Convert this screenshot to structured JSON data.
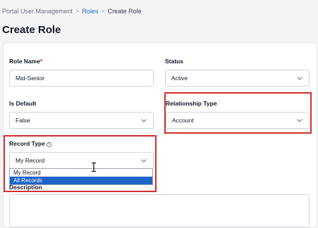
{
  "breadcrumb": {
    "root": "Portal User Management",
    "roles": "Roles",
    "current": "Create Role",
    "separator": ">"
  },
  "page_title": "Create Role",
  "form": {
    "role_name": {
      "label": "Role Name",
      "required_mark": "*",
      "value": "Mid-Senior"
    },
    "status": {
      "label": "Status",
      "value": "Active"
    },
    "is_default": {
      "label": "Is Default",
      "value": "False"
    },
    "relationship_type": {
      "label": "Relationship Type",
      "value": "Account"
    },
    "record_type": {
      "label": "Record Type",
      "info_icon": "i",
      "value": "My Record",
      "options": [
        "My Record",
        "All Records"
      ],
      "highlighted_option": "All Records"
    },
    "description": {
      "label": "Description",
      "value": ""
    }
  },
  "colors": {
    "link": "#2b6cb0",
    "required": "#dc2626",
    "highlight_box": "#d32f2f",
    "option_selected": "#1e63c8"
  },
  "icons": [
    "chevron-down-icon",
    "info-icon",
    "text-cursor-icon"
  ]
}
